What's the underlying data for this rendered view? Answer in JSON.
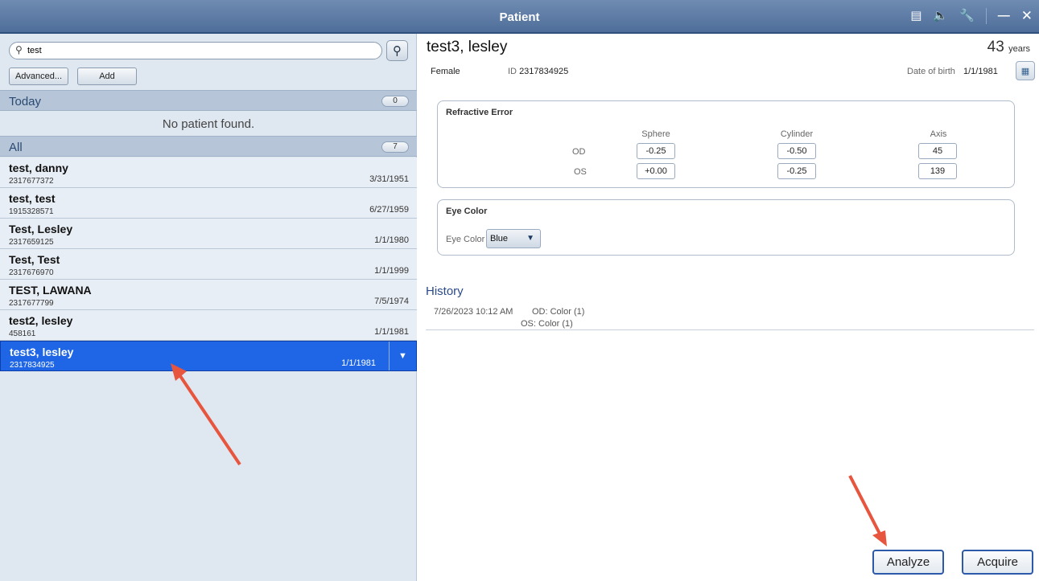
{
  "window": {
    "title": "Patient"
  },
  "search": {
    "value": "test",
    "advanced_label": "Advanced...",
    "add_label": "Add"
  },
  "sections": {
    "today": {
      "label": "Today",
      "count": "0",
      "empty_text": "No patient found."
    },
    "all": {
      "label": "All",
      "count": "7"
    }
  },
  "patients": [
    {
      "name": "test, danny",
      "id": "2317677372",
      "dob": "3/31/1951"
    },
    {
      "name": "test, test",
      "id": "1915328571",
      "dob": "6/27/1959"
    },
    {
      "name": "Test, Lesley",
      "id": "2317659125",
      "dob": "1/1/1980"
    },
    {
      "name": "Test, Test",
      "id": "2317676970",
      "dob": "1/1/1999"
    },
    {
      "name": "TEST, LAWANA",
      "id": "2317677799",
      "dob": "7/5/1974"
    },
    {
      "name": "test2, lesley",
      "id": "458161",
      "dob": "1/1/1981"
    },
    {
      "name": "test3, lesley",
      "id": "2317834925",
      "dob": "1/1/1981"
    }
  ],
  "detail": {
    "name": "test3, lesley",
    "age": "43",
    "age_unit": "years",
    "gender": "Female",
    "id_label": "ID",
    "id": "2317834925",
    "dob_label": "Date of birth",
    "dob": "1/1/1981"
  },
  "refractive": {
    "title": "Refractive Error",
    "col_sphere": "Sphere",
    "col_cylinder": "Cylinder",
    "col_axis": "Axis",
    "od_label": "OD",
    "os_label": "OS",
    "od": {
      "sphere": "-0.25",
      "cylinder": "-0.50",
      "axis": "45"
    },
    "os": {
      "sphere": "+0.00",
      "cylinder": "-0.25",
      "axis": "139"
    }
  },
  "eye_color": {
    "title": "Eye Color",
    "label": "Eye Color",
    "value": "Blue"
  },
  "history": {
    "title": "History",
    "entries": [
      {
        "date": "7/26/2023 10:12 AM",
        "od": "OD: Color (1)",
        "os": "OS: Color (1)"
      }
    ]
  },
  "actions": {
    "analyze_label": "Analyze",
    "acquire_label": "Acquire"
  },
  "colors": {
    "accent": "#1e66e6",
    "titlebar": "#5a7aa5",
    "annotation_arrow": "#e8553f"
  }
}
